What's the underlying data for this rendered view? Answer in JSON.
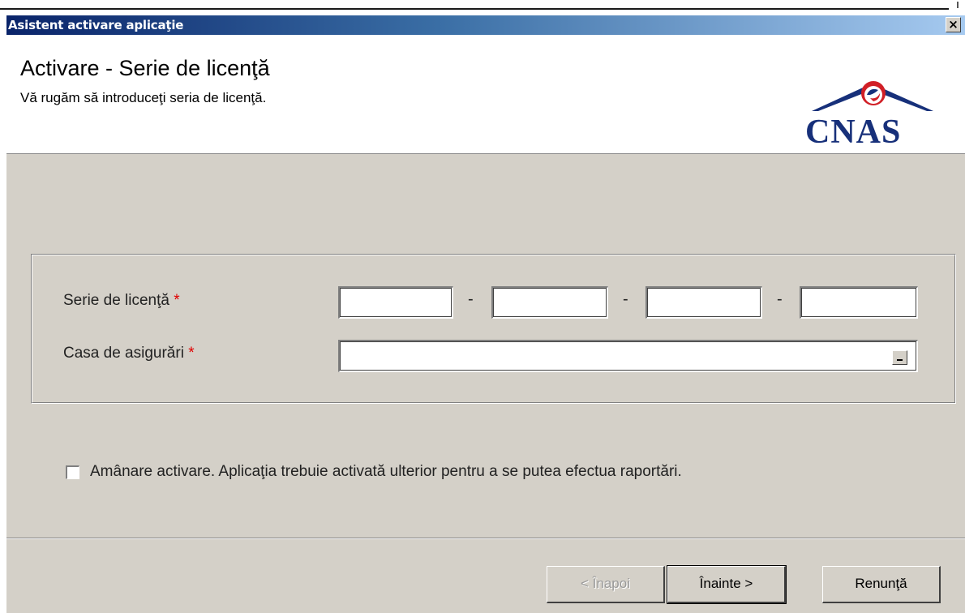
{
  "window": {
    "title": "Asistent activare aplicaţie",
    "close_glyph": "×"
  },
  "header": {
    "title": "Activare - Serie de licenţă",
    "subtitle": "Vă rugăm să introduceţi seria de licenţă.",
    "logo_text": "CNAS",
    "logo_colors": {
      "blue": "#17307a",
      "red": "#d11f26"
    }
  },
  "form": {
    "license_label": "Serie de licenţă",
    "required_mark": "*",
    "license_separator": "-",
    "license_fields": [
      "",
      "",
      "",
      ""
    ],
    "casa_label": "Casa de asigurări",
    "casa_value": ""
  },
  "defer": {
    "checked": false,
    "label": "Amânare activare. Aplicaţia trebuie activată ulterior pentru a se putea efectua raportări."
  },
  "buttons": {
    "back": "< Înapoi",
    "next": "Înainte >",
    "cancel": "Renunţă"
  }
}
